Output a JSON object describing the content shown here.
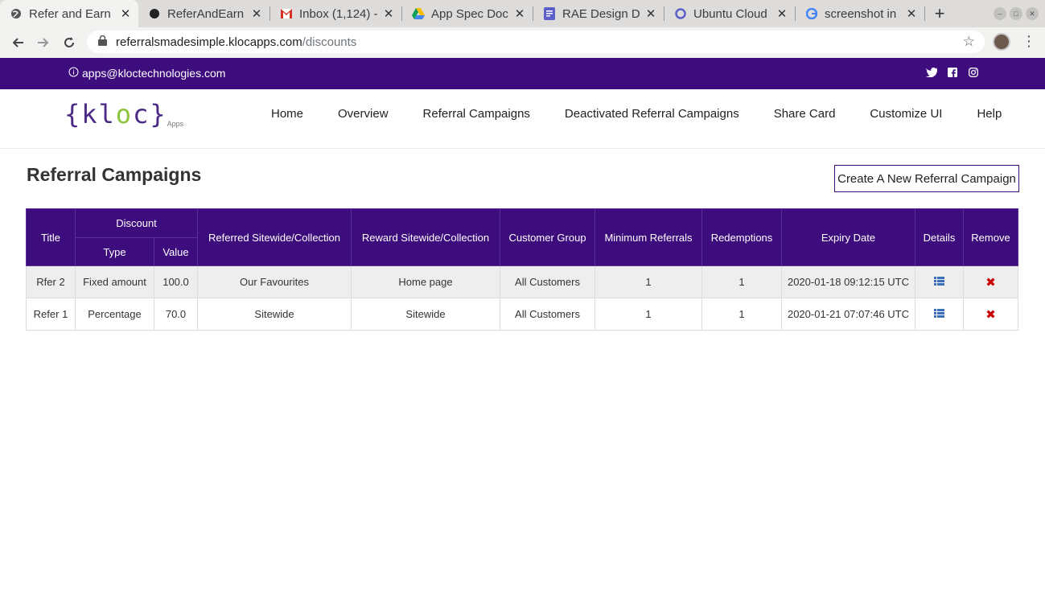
{
  "browser": {
    "tabs": [
      {
        "title": "Refer and Earn",
        "icon": "globe-icon",
        "active": true
      },
      {
        "title": "ReferAndEarn",
        "icon": "github-icon",
        "active": false
      },
      {
        "title": "Inbox (1,124) -",
        "icon": "gmail-icon",
        "active": false
      },
      {
        "title": "App Spec Docs",
        "icon": "drive-icon",
        "active": false
      },
      {
        "title": "RAE Design Do",
        "icon": "docs-icon",
        "active": false
      },
      {
        "title": "Ubuntu Cloud",
        "icon": "ubuntu-icon",
        "active": false
      },
      {
        "title": "screenshot in u",
        "icon": "google-icon",
        "active": false
      }
    ],
    "url_host": "referralsmadesimple.klocapps.com",
    "url_path": "/discounts"
  },
  "topbar": {
    "email": "apps@kloctechnologies.com"
  },
  "logo": {
    "open": "{k",
    "l": "l",
    "o": "o",
    "close": "c}",
    "apps": "Apps"
  },
  "nav": [
    "Home",
    "Overview",
    "Referral Campaigns",
    "Deactivated Referral Campaigns",
    "Share Card",
    "Customize UI",
    "Help"
  ],
  "page": {
    "title": "Referral Campaigns",
    "create_button": "Create A New Referral Campaign"
  },
  "table": {
    "headers": {
      "title": "Title",
      "discount": "Discount",
      "type": "Type",
      "value": "Value",
      "referred": "Referred Sitewide/Collection",
      "reward": "Reward Sitewide/Collection",
      "group": "Customer Group",
      "min_ref": "Minimum Referrals",
      "redemptions": "Redemptions",
      "expiry": "Expiry Date",
      "details": "Details",
      "remove": "Remove"
    },
    "rows": [
      {
        "title": "Rfer 2",
        "type": "Fixed amount",
        "value": "100.0",
        "referred": "Our Favourites",
        "reward": "Home page",
        "group": "All Customers",
        "min_ref": "1",
        "redemptions": "1",
        "expiry": "2020-01-18 09:12:15 UTC"
      },
      {
        "title": "Refer 1",
        "type": "Percentage",
        "value": "70.0",
        "referred": "Sitewide",
        "reward": "Sitewide",
        "group": "All Customers",
        "min_ref": "1",
        "redemptions": "1",
        "expiry": "2020-01-21 07:07:46 UTC"
      }
    ]
  },
  "colors": {
    "brand_purple": "#3d0c7d",
    "logo_green": "#8cc43f",
    "details_blue": "#3d6fb8",
    "remove_red": "#cc0000"
  }
}
